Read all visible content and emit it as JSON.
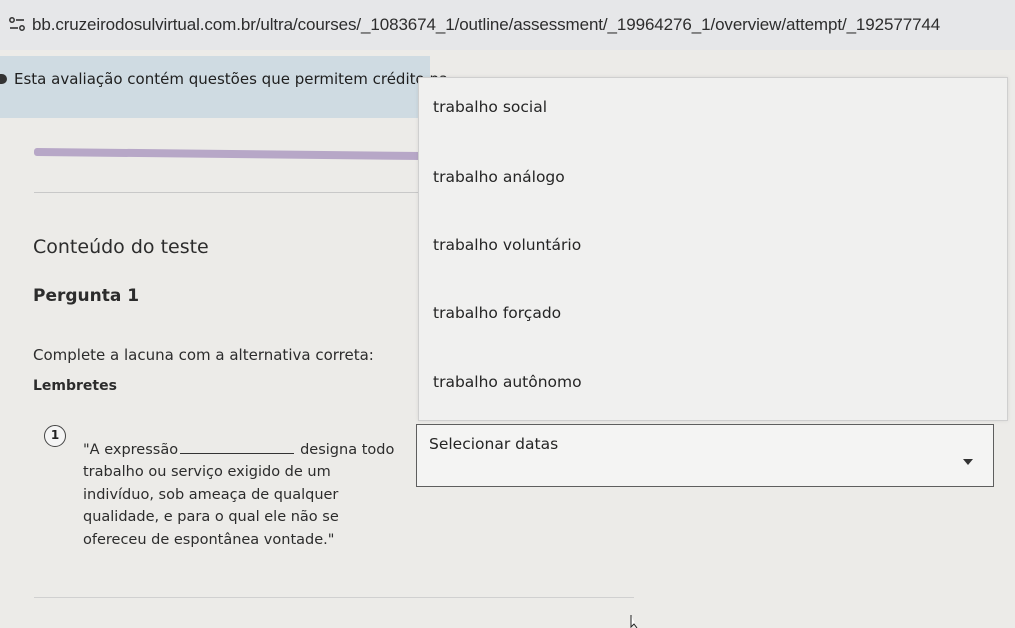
{
  "browser": {
    "url": "bb.cruzeirodosulvirtual.com.br/ultra/courses/_1083674_1/outline/assessment/_19964276_1/overview/attempt/_192577744",
    "site_icon": "site-info-icon"
  },
  "notice": {
    "text": "Esta avaliação contém questões que permitem crédito pa"
  },
  "test": {
    "section_title": "Conteúdo do teste",
    "question_title": "Pergunta 1",
    "instruction": "Complete a lacuna com a alternativa correta:",
    "reminders_label": "Lembretes"
  },
  "question": {
    "number": "1",
    "line1_before": "\"A expressão",
    "line1_after": "designa todo",
    "line2": "trabalho ou serviço exigido de um",
    "line3": "indivíduo, sob ameaça de qualquer",
    "line4": "qualidade, e para o qual ele não se",
    "line5": "ofereceu de espontânea vontade.\""
  },
  "dropdown": {
    "options": [
      "trabalho social",
      "trabalho análogo",
      "trabalho voluntário",
      "trabalho forçado",
      "trabalho autônomo"
    ],
    "selected_label": "Selecionar datas",
    "arrow_icon": "chevron-down-icon"
  },
  "colors": {
    "notice_band": "#cfdbe2",
    "progress": "#b7a7c7",
    "page_bg": "#ecebe8"
  }
}
